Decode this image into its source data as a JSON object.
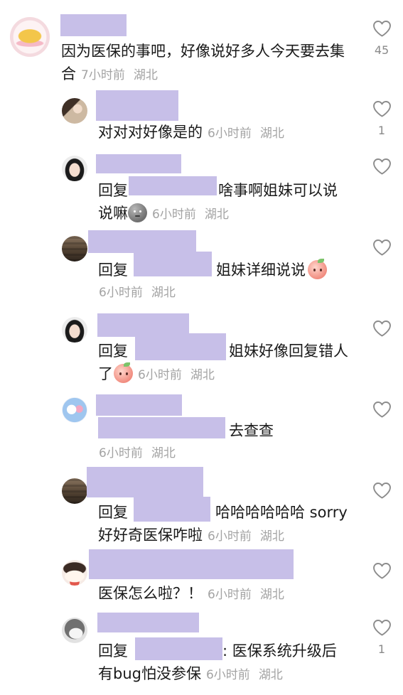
{
  "comments": [
    {
      "text": "因为医保的事吧，好像说好多人今天要去集合",
      "time": "7小时前",
      "location": "湖北",
      "likes": "45"
    },
    {
      "text": "对对对好像是的",
      "time": "6小时前",
      "location": "湖北",
      "likes": "1"
    },
    {
      "reply_label": "回复",
      "text": "啥事啊姐妹可以说说嘛",
      "emoji": "gray-blob-emoji",
      "time": "6小时前",
      "location": "湖北"
    },
    {
      "reply_label": "回复",
      "text": "姐妹详细说说",
      "emoji": "peach-face-emoji",
      "time": "6小时前",
      "location": "湖北"
    },
    {
      "reply_label": "回复",
      "text": "姐妹好像回复错人了",
      "emoji": "peach-face-emoji",
      "time": "6小时前",
      "location": "湖北"
    },
    {
      "text": "去查查",
      "time": "6小时前",
      "location": "湖北"
    },
    {
      "reply_label": "回复",
      "text": "哈哈哈哈哈哈 sorry好好奇医保咋啦",
      "time": "6小时前",
      "location": "湖北"
    },
    {
      "text": "医保怎么啦？！",
      "time": "6小时前",
      "location": "湖北"
    },
    {
      "reply_label": "回复",
      "text": ": 医保系统升级后有bug怕没参保",
      "time": "6小时前",
      "location": "湖北",
      "likes": "1"
    }
  ],
  "icons": {
    "like": "heart-icon"
  },
  "colors": {
    "background": "#ffffff",
    "text": "#1a1a1a",
    "meta": "#a3a3a3",
    "icon": "#8c8c8c",
    "redaction": "#c7bfe8"
  }
}
